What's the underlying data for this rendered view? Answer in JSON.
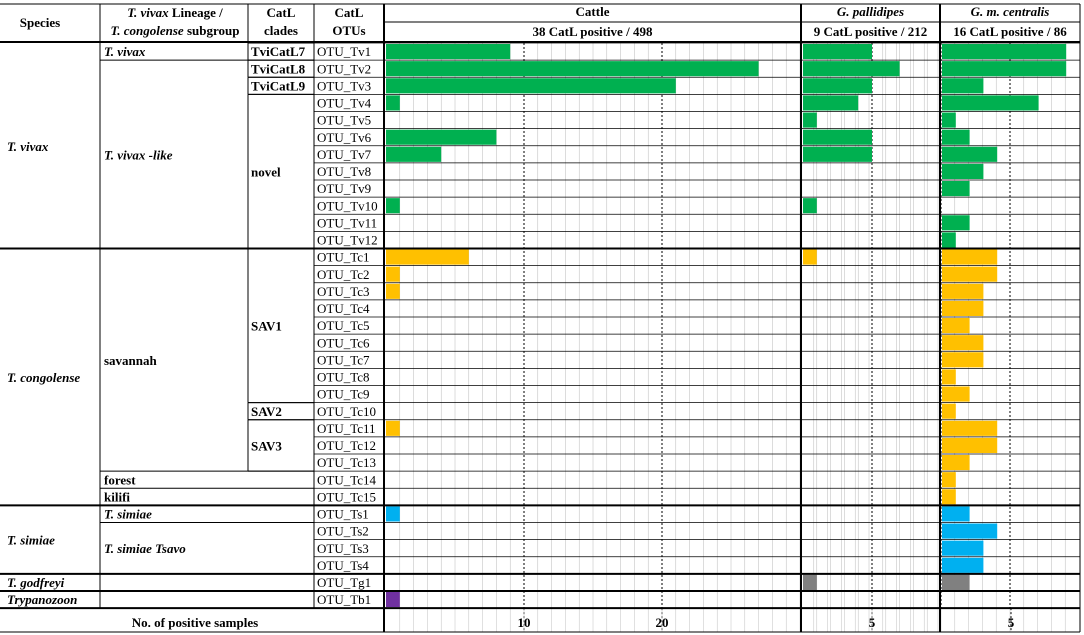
{
  "headers": {
    "species": "Species",
    "lineage_line1_italic": "T. vivax",
    "lineage_line1_rest": " Lineage /",
    "lineage_line2_italic": "T. congolense",
    "lineage_line2_rest": " subgroup",
    "clades_line1": "CatL",
    "clades_line2": "clades",
    "otus_line1": "CatL",
    "otus_line2": "OTUs"
  },
  "panels": [
    {
      "host": "Cattle",
      "host_italic": false,
      "summary": "38 CatL positive / 498",
      "ticks": [
        10,
        20
      ]
    },
    {
      "host": "G. pallidipes",
      "host_italic": true,
      "summary": "9 CatL positive / 212",
      "ticks": [
        5
      ]
    },
    {
      "host": "G. m. centralis",
      "host_italic": true,
      "summary": "16 CatL positive / 86",
      "ticks": [
        5
      ]
    }
  ],
  "footer_label": "No. of positive samples",
  "colors": {
    "T. vivax": "#00b050",
    "T. congolense": "#ffc000",
    "T. simiae": "#00b0f0",
    "T. godfreyi": "#808080",
    "Trypanozoon": "#7030a0"
  },
  "species": [
    {
      "name": "T. vivax",
      "italic": true
    },
    {
      "name": "T. congolense",
      "italic": true
    },
    {
      "name": "T. simiae",
      "italic": true
    },
    {
      "name": "T. godfreyi",
      "italic": true
    },
    {
      "name": "Trypanozoon",
      "italic": true
    }
  ],
  "lineages": [
    {
      "name": "T. vivax",
      "italic": true
    },
    {
      "name": "T. vivax -like",
      "italic": true
    },
    {
      "name": "savannah",
      "italic": false
    },
    {
      "name": "forest",
      "italic": false
    },
    {
      "name": "kilifi",
      "italic": false
    },
    {
      "name": "T. simiae",
      "italic": true
    },
    {
      "name": "T. simiae Tsavo",
      "italic": true
    }
  ],
  "clades": [
    "TviCatL7",
    "TviCatL8",
    "TviCatL9",
    "novel",
    "SAV1",
    "SAV2",
    "SAV3"
  ],
  "chart_data": {
    "type": "bar",
    "orientation": "horizontal",
    "xlabel": "No. of positive samples",
    "categories": [
      "OTU_Tv1",
      "OTU_Tv2",
      "OTU_Tv3",
      "OTU_Tv4",
      "OTU_Tv5",
      "OTU_Tv6",
      "OTU_Tv7",
      "OTU_Tv8",
      "OTU_Tv9",
      "OTU_Tv10",
      "OTU_Tv11",
      "OTU_Tv12",
      "OTU_Tc1",
      "OTU_Tc2",
      "OTU_Tc3",
      "OTU_Tc4",
      "OTU_Tc5",
      "OTU_Tc6",
      "OTU_Tc7",
      "OTU_Tc8",
      "OTU_Tc9",
      "OTU_Tc10",
      "OTU_Tc11",
      "OTU_Tc12",
      "OTU_Tc13",
      "OTU_Tc14",
      "OTU_Tc15",
      "OTU_Ts1",
      "OTU_Ts2",
      "OTU_Ts3",
      "OTU_Ts4",
      "OTU_Tg1",
      "OTU_Tb1"
    ],
    "row_species": [
      "T. vivax",
      "T. vivax",
      "T. vivax",
      "T. vivax",
      "T. vivax",
      "T. vivax",
      "T. vivax",
      "T. vivax",
      "T. vivax",
      "T. vivax",
      "T. vivax",
      "T. vivax",
      "T. congolense",
      "T. congolense",
      "T. congolense",
      "T. congolense",
      "T. congolense",
      "T. congolense",
      "T. congolense",
      "T. congolense",
      "T. congolense",
      "T. congolense",
      "T. congolense",
      "T. congolense",
      "T. congolense",
      "T. congolense",
      "T. congolense",
      "T. simiae",
      "T. simiae",
      "T. simiae",
      "T. simiae",
      "T. godfreyi",
      "Trypanozoon"
    ],
    "series": [
      {
        "name": "Cattle",
        "xlim": [
          0,
          27
        ],
        "values": [
          9,
          27,
          21,
          1,
          0,
          8,
          4,
          0,
          0,
          1,
          0,
          0,
          6,
          1,
          1,
          0,
          0,
          0,
          0,
          0,
          0,
          0,
          1,
          0,
          0,
          0,
          0,
          1,
          0,
          0,
          0,
          0,
          1
        ]
      },
      {
        "name": "G. pallidipes",
        "xlim": [
          0,
          9
        ],
        "values": [
          5,
          7,
          5,
          4,
          1,
          5,
          5,
          0,
          0,
          1,
          0,
          0,
          1,
          0,
          0,
          0,
          0,
          0,
          0,
          0,
          0,
          0,
          0,
          0,
          0,
          0,
          0,
          0,
          0,
          0,
          0,
          1,
          0
        ]
      },
      {
        "name": "G. m. centralis",
        "xlim": [
          0,
          9
        ],
        "values": [
          9,
          9,
          3,
          7,
          1,
          2,
          4,
          3,
          2,
          0,
          2,
          1,
          4,
          4,
          3,
          3,
          2,
          3,
          3,
          1,
          2,
          1,
          4,
          4,
          2,
          1,
          1,
          2,
          4,
          3,
          3,
          2,
          0
        ]
      }
    ],
    "grid": true
  }
}
